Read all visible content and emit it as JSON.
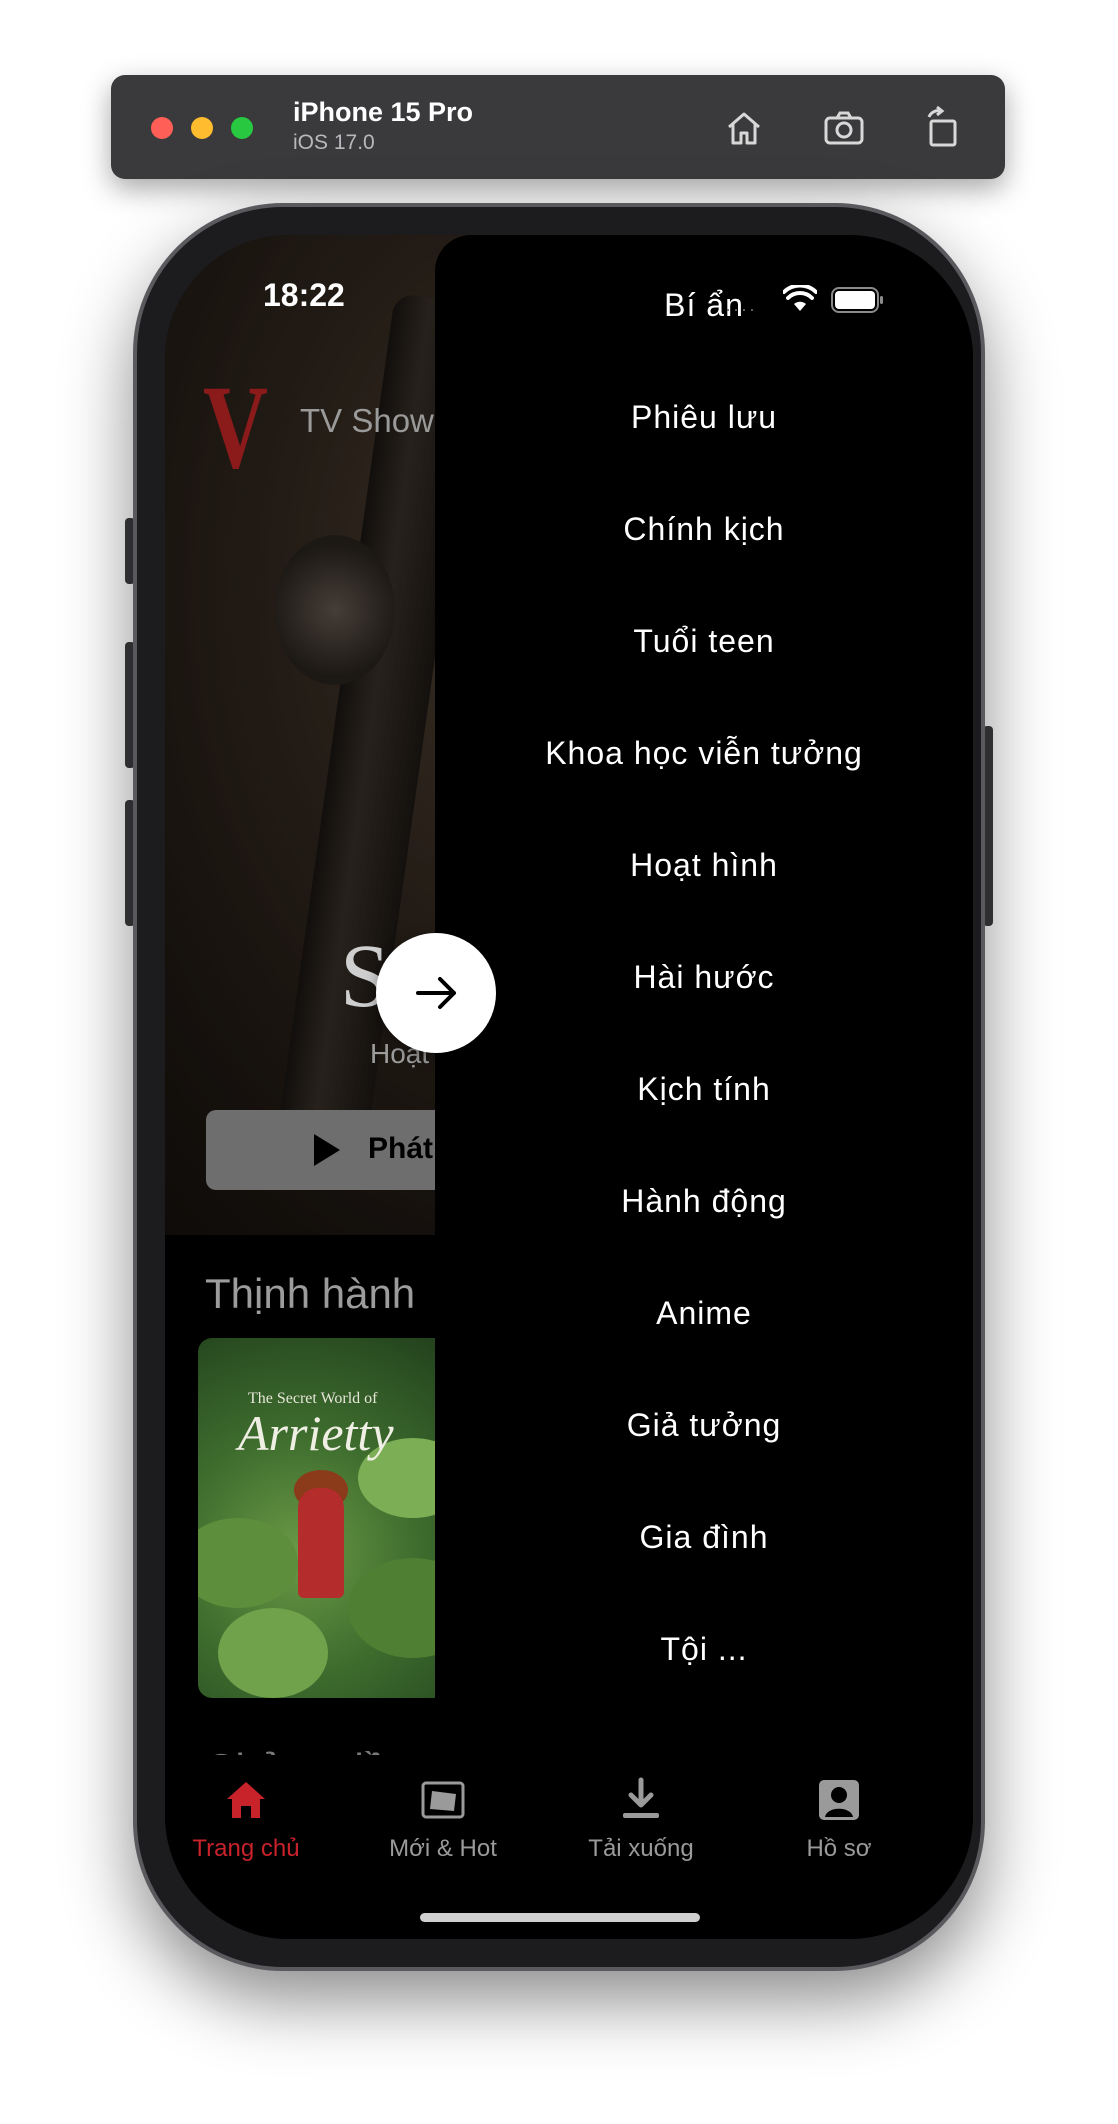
{
  "simulator": {
    "device_name": "iPhone 15 Pro",
    "os_version": "iOS 17.0",
    "buttons": [
      "home-icon",
      "screenshot-icon",
      "rotate-icon"
    ]
  },
  "status_bar": {
    "time": "18:22",
    "signal": "····"
  },
  "app": {
    "logo": "V",
    "top_nav_partial": "TV Show",
    "hero": {
      "title_partial": "S",
      "genre_partial": "Hoạt",
      "play_label_partial": "Phát"
    },
    "sections": [
      {
        "title_partial": "Thịnh hành"
      },
      {
        "title_partial": "Chủ ... đề"
      }
    ],
    "poster": {
      "title_small": "The Secret World of",
      "title_large": "Arrietty"
    }
  },
  "drawer": {
    "genres": [
      "Bí ẩn",
      "Phiêu lưu",
      "Chính kịch",
      "Tuổi teen",
      "Khoa học viễn tưởng",
      "Hoạt hình",
      "Hài hước",
      "Kịch tính",
      "Hành động",
      "Anime",
      "Giả tưởng",
      "Gia đình",
      "Tội ..."
    ]
  },
  "tab_bar": {
    "items": [
      {
        "label": "Trang chủ",
        "icon": "home-icon",
        "active": true
      },
      {
        "label": "Mới & Hot",
        "icon": "photo-icon",
        "active": false
      },
      {
        "label": "Tải xuống",
        "icon": "download-icon",
        "active": false
      },
      {
        "label": "Hồ sơ",
        "icon": "profile-icon",
        "active": false
      }
    ]
  },
  "colors": {
    "accent": "#c8222a",
    "background": "#000000",
    "text": "#ffffff"
  }
}
